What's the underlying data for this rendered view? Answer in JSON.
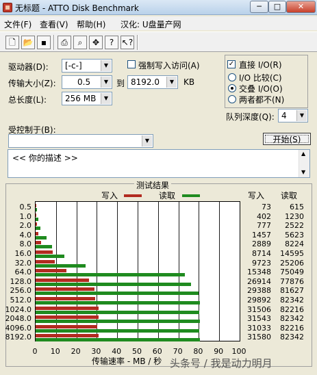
{
  "window": {
    "title": "无标题 - ATTO Disk Benchmark",
    "minimize": "─",
    "maximize": "□",
    "close": "✕"
  },
  "menu": [
    "文件(F)",
    "查看(V)",
    "帮助(H)",
    "汉化: U盘量产网"
  ],
  "toolbar": [
    "new-icon",
    "open-icon",
    "save-icon",
    "print-icon",
    "print-preview-icon",
    "move-icon",
    "help-icon",
    "context-help-icon"
  ],
  "settings": {
    "drive_label": "驱动器(D):",
    "drive_value": "[-c-]",
    "direct_write_label": "强制写入访问(A)",
    "transfer_label": "传输大小(Z):",
    "transfer_from": "0.5",
    "to_label": "到",
    "transfer_to": "8192.0",
    "kb_label": "KB",
    "length_label": "总长度(L):",
    "length_value": "256 MB",
    "direct_io_label": "直接 I/O(R)",
    "io_compare_label": "I/O 比较(C)",
    "overlapped_label": "交叠 I/O(O)",
    "neither_label": "两者都不(N)",
    "queue_label": "队列深度(Q):",
    "queue_value": "4",
    "controlled_label": "受控制于(B):",
    "controlled_value": "",
    "start_button": "开始(S)",
    "description": "<<  你的描述  >>"
  },
  "results": {
    "title": "测试结果",
    "write_legend": "写入",
    "read_legend": "读取",
    "write_header": "写入",
    "read_header": "读取",
    "xlabel": "传输速率 - MB / 秒"
  },
  "watermark": "头条号 / 我是动力明月",
  "chart_data": {
    "type": "bar",
    "orientation": "horizontal",
    "title": "测试结果",
    "xlabel": "传输速率 - MB / 秒",
    "xlim": [
      0,
      100
    ],
    "xticks": [
      0,
      10,
      20,
      30,
      40,
      50,
      60,
      70,
      80,
      90,
      100
    ],
    "categories": [
      "0.5",
      "1.0",
      "2.0",
      "4.0",
      "8.0",
      "16.0",
      "32.0",
      "64.0",
      "128.0",
      "256.0",
      "512.0",
      "1024.0",
      "2048.0",
      "4096.0",
      "8192.0"
    ],
    "series": [
      {
        "name": "写入",
        "color": "#b22b20",
        "values": [
          0.07,
          0.39,
          0.76,
          1.42,
          2.82,
          8.51,
          9.5,
          14.99,
          26.28,
          28.7,
          29.19,
          30.77,
          30.81,
          30.31,
          30.84
        ]
      },
      {
        "name": "读取",
        "color": "#1f8b1f",
        "values": [
          0.6,
          1.2,
          2.46,
          5.49,
          8.03,
          14.25,
          24.61,
          73.29,
          76.05,
          79.71,
          80.41,
          80.29,
          80.41,
          80.29,
          80.41
        ]
      }
    ],
    "write_text": [
      "73",
      "402",
      "777",
      "1457",
      "2889",
      "8714",
      "9723",
      "15348",
      "26914",
      "29388",
      "29892",
      "31506",
      "31543",
      "31033",
      "31580"
    ],
    "read_text": [
      "615",
      "1230",
      "2522",
      "5623",
      "8224",
      "14595",
      "25206",
      "75049",
      "77876",
      "81627",
      "82342",
      "82216",
      "82342",
      "82216",
      "82342"
    ],
    "grid": true,
    "legend": "top-center"
  }
}
